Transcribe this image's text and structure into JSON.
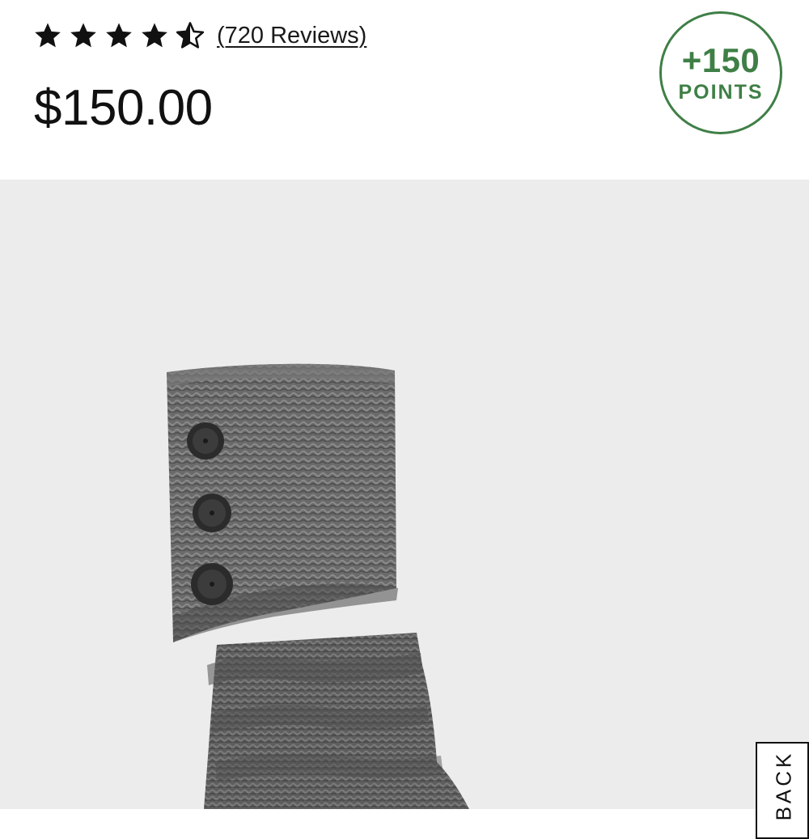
{
  "product": {
    "rating": {
      "value": 4.5,
      "max": 5,
      "stars": [
        "full",
        "full",
        "full",
        "full",
        "half"
      ]
    },
    "reviews_label": "(720 Reviews)",
    "price": "$150.00"
  },
  "points_badge": {
    "value": "+150",
    "label": "POINTS"
  },
  "side_tab": {
    "label": "BACK"
  },
  "colors": {
    "points_green": "#3f7f46",
    "text": "#111111",
    "image_background": "#ececec",
    "knit_gray": "#6b6b6b"
  },
  "icons": {
    "star_full": "star-icon",
    "star_half": "star-half-icon",
    "button_toggle": "toggle-button-icon"
  }
}
